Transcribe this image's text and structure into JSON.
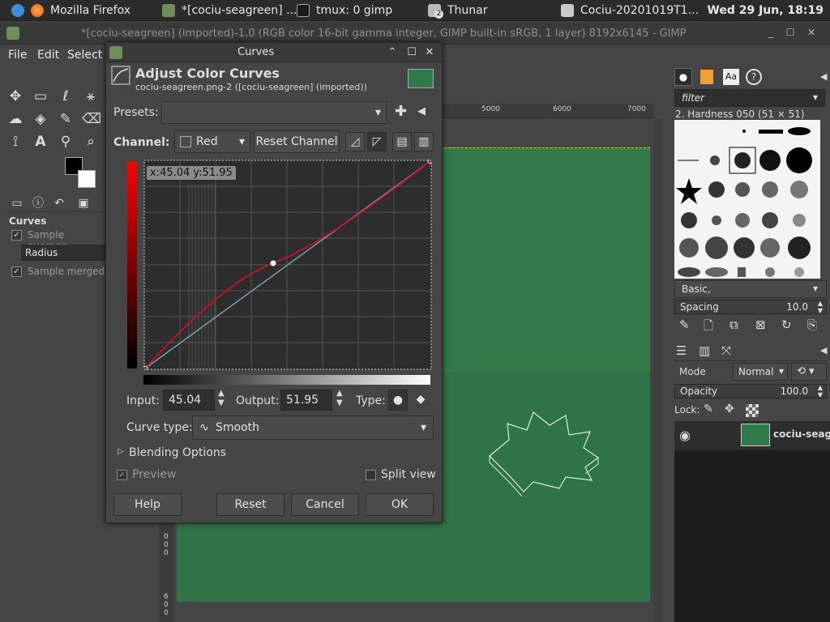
{
  "taskbar": {
    "apps": [
      {
        "label": "Mozilla Firefox",
        "icon": "firefox-icon"
      },
      {
        "label": "*[cociu-seagreen] ...",
        "icon": "gimp-icon"
      },
      {
        "label": "tmux: 0 gimp",
        "icon": "terminal-icon"
      },
      {
        "label": "Thunar",
        "icon": "folder-icon",
        "badge": "2"
      },
      {
        "label": "Cociu-20201019T1...",
        "icon": "inkscape-icon"
      }
    ],
    "clock": "Wed 29 Jun, 18:19"
  },
  "gimp_window": {
    "title": "*[cociu-seagreen] (imported)-1.0 (RGB color 16-bit gamma integer, GIMP built-in sRGB, 1 layer) 8192x6145 - GIMP",
    "menu": [
      "File",
      "Edit",
      "Select"
    ]
  },
  "tool_options": {
    "title": "Curves",
    "sample_average": "Sample average",
    "radius_label": "Radius",
    "sample_merged": "Sample merged"
  },
  "ruler": {
    "marks": [
      "5000",
      "6000",
      "7000"
    ],
    "left_marks": [
      "0",
      "0",
      "0",
      "6",
      "0",
      "0"
    ]
  },
  "dialog": {
    "window_title": "Curves",
    "heading": "Adjust Color Curves",
    "subtitle": "cociu-seagreen.png-2 ([cociu-seagreen] (imported))",
    "presets_label": "Presets:",
    "presets_value": "",
    "channel_label": "Channel:",
    "channel_value": "Red",
    "reset_channel": "Reset Channel",
    "tooltip": "x:45.04 y:51.95",
    "input_label": "Input:",
    "input_value": "45.04",
    "output_label": "Output:",
    "output_value": "51.95",
    "type_label": "Type:",
    "curve_type_label": "Curve type:",
    "curve_type_value": "Smooth",
    "blending_options": "Blending Options",
    "preview": "Preview",
    "split_view": "Split view",
    "help": "Help",
    "reset": "Reset",
    "cancel": "Cancel",
    "ok": "OK"
  },
  "dock": {
    "filter_placeholder": "filter",
    "brush_name": "2. Hardness 050 (51 × 51)",
    "brush_set": "Basic,",
    "spacing_label": "Spacing",
    "spacing_value": "10.0",
    "mode_label": "Mode",
    "mode_value": "Normal",
    "opacity_label": "Opacity",
    "opacity_value": "100.0",
    "lock_label": "Lock:",
    "layer_name": "cociu-seag"
  },
  "colors": {
    "accent_red": "#cc1020",
    "image_green": "#327a4a"
  }
}
